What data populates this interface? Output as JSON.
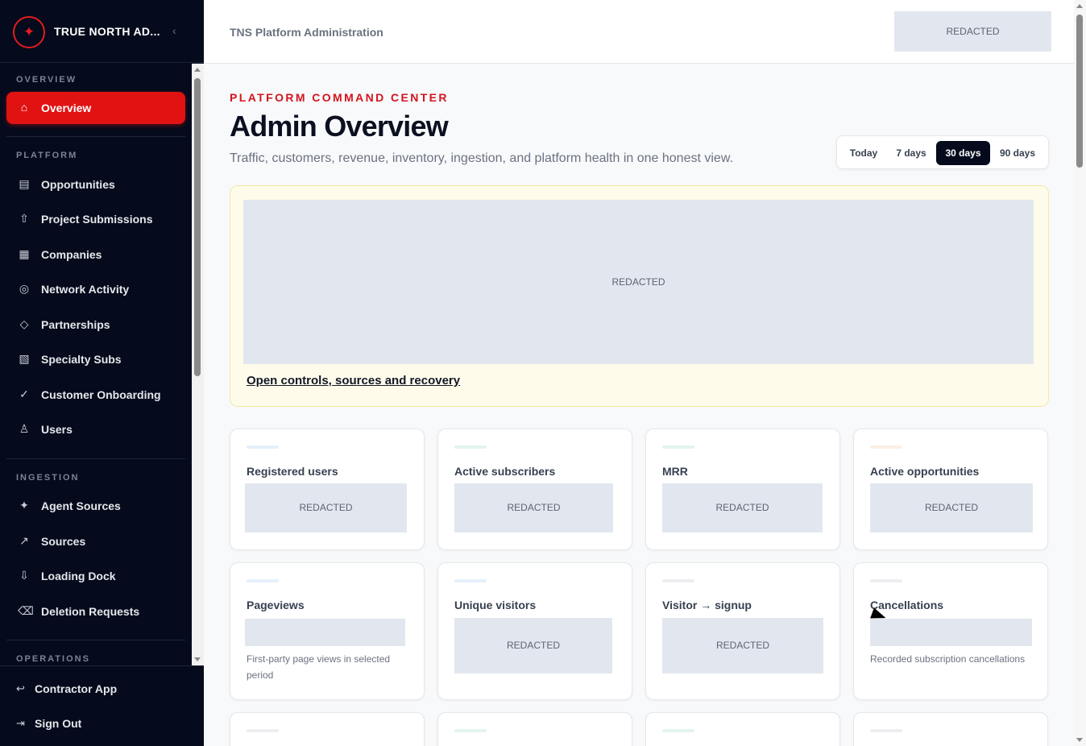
{
  "brand": {
    "name": "TRUE NORTH AD...",
    "logo_icon": "compass-star-icon",
    "collapse_glyph": "‹"
  },
  "sidebar": {
    "sections": [
      {
        "label": "OVERVIEW"
      },
      {
        "label": "PLATFORM"
      },
      {
        "label": "INGESTION"
      },
      {
        "label": "OPERATIONS"
      }
    ],
    "items": [
      {
        "label": "Overview",
        "icon": "⌂",
        "active": true
      },
      {
        "label": "Opportunities",
        "icon": "▤"
      },
      {
        "label": "Project Submissions",
        "icon": "⇧"
      },
      {
        "label": "Companies",
        "icon": "▦"
      },
      {
        "label": "Network Activity",
        "icon": "◎"
      },
      {
        "label": "Partnerships",
        "icon": "◇"
      },
      {
        "label": "Specialty Subs",
        "icon": "▧"
      },
      {
        "label": "Customer Onboarding",
        "icon": "✓"
      },
      {
        "label": "Users",
        "icon": "♙"
      },
      {
        "label": "Agent Sources",
        "icon": "✦"
      },
      {
        "label": "Sources",
        "icon": "↗"
      },
      {
        "label": "Loading Dock",
        "icon": "⇩"
      },
      {
        "label": "Deletion Requests",
        "icon": "⌫"
      }
    ],
    "footer": [
      {
        "label": "Contractor App",
        "icon": "↩"
      },
      {
        "label": "Sign Out",
        "icon": "⇥"
      }
    ]
  },
  "topbar": {
    "title": "TNS Platform Administration",
    "redacted": "REDACTED"
  },
  "header": {
    "eyebrow": "PLATFORM COMMAND CENTER",
    "title": "Admin Overview",
    "subtitle": "Traffic, customers, revenue, inventory, ingestion, and platform health in one honest view."
  },
  "range": {
    "options": [
      "Today",
      "7 days",
      "30 days",
      "90 days"
    ],
    "selected": "30 days"
  },
  "alert": {
    "redacted": "REDACTED",
    "link": "Open controls, sources and recovery"
  },
  "cards": [
    {
      "title": "Registered users",
      "value": "REDACTED",
      "accent": "#e5f0fa"
    },
    {
      "title": "Active subscribers",
      "value": "REDACTED",
      "accent": "#e3f5ec"
    },
    {
      "title": "MRR",
      "value": "REDACTED",
      "accent": "#e3f5ec"
    },
    {
      "title": "Active opportunities",
      "value": "REDACTED",
      "accent": "#fcefe3"
    },
    {
      "title": "Pageviews",
      "value": "",
      "desc": "First-party page views in selected period",
      "accent": "#e5f0fa"
    },
    {
      "title": "Unique visitors",
      "value": "REDACTED",
      "accent": "#e5f0fa"
    },
    {
      "title": "Visitor → signup",
      "value": "REDACTED",
      "accent": "#eceef1"
    },
    {
      "title": "Cancellations",
      "value": "",
      "desc": "Recorded subscription cancellations",
      "accent": "#eceef1"
    }
  ],
  "colors": {
    "accent": "#e11212",
    "sidebar_bg": "#050b1c",
    "eyebrow": "#d4141c"
  }
}
